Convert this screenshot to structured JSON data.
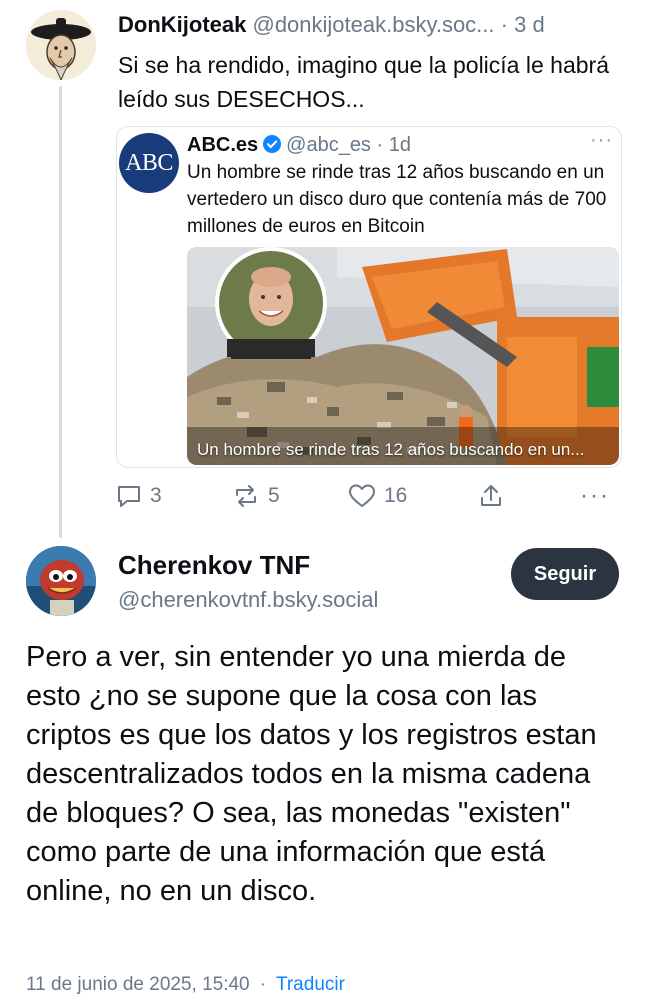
{
  "thread": {
    "parent_post": {
      "author_name": "DonKijoteak",
      "author_handle": "@donkijoteak.bsky.soc...",
      "separator": "·",
      "time": "3 d",
      "text": "Si se ha rendido, imagino que la policía le habrá leído sus DESECHOS...",
      "embed": {
        "avatar_text": "ABC",
        "author_name": "ABC.es",
        "author_handle": "@abc_es",
        "separator": "·",
        "time": "1d",
        "more": "···",
        "text": "Un hombre se rinde tras 12 años buscando en un vertedero un disco duro que contenía más de 700 millones de euros en Bitcoin",
        "image_caption": "Un hombre se rinde tras 12 años buscando en un..."
      },
      "actions": {
        "reply_count": "3",
        "repost_count": "5",
        "like_count": "16",
        "more": "···"
      }
    },
    "focused_post": {
      "author_name": "Cherenkov TNF",
      "author_handle": "@cherenkovtnf.bsky.social",
      "follow_label": "Seguir",
      "text": "Pero a ver, sin entender yo una mierda de esto ¿no se supone que la cosa con las criptos es que los datos y los registros estan descentralizados todos en la misma cadena de bloques? O sea, las monedas \"existen\" como parte de una información que está online, no en un disco.",
      "timestamp": "11 de junio de 2025, 15:40",
      "separator": "·",
      "translate_label": "Traducir"
    }
  },
  "colors": {
    "text": "#0b0f14",
    "muted": "#6a7887",
    "link": "#1083fe",
    "follow_button": "#2b3440",
    "verified_badge": "#1083fe",
    "abc_blue": "#183c7a"
  },
  "icons": {
    "reply": "speech-bubble-icon",
    "repost": "repost-arrows-icon",
    "like": "heart-icon",
    "share": "share-upload-icon",
    "more": "ellipsis-icon",
    "verified": "verified-badge-icon"
  }
}
